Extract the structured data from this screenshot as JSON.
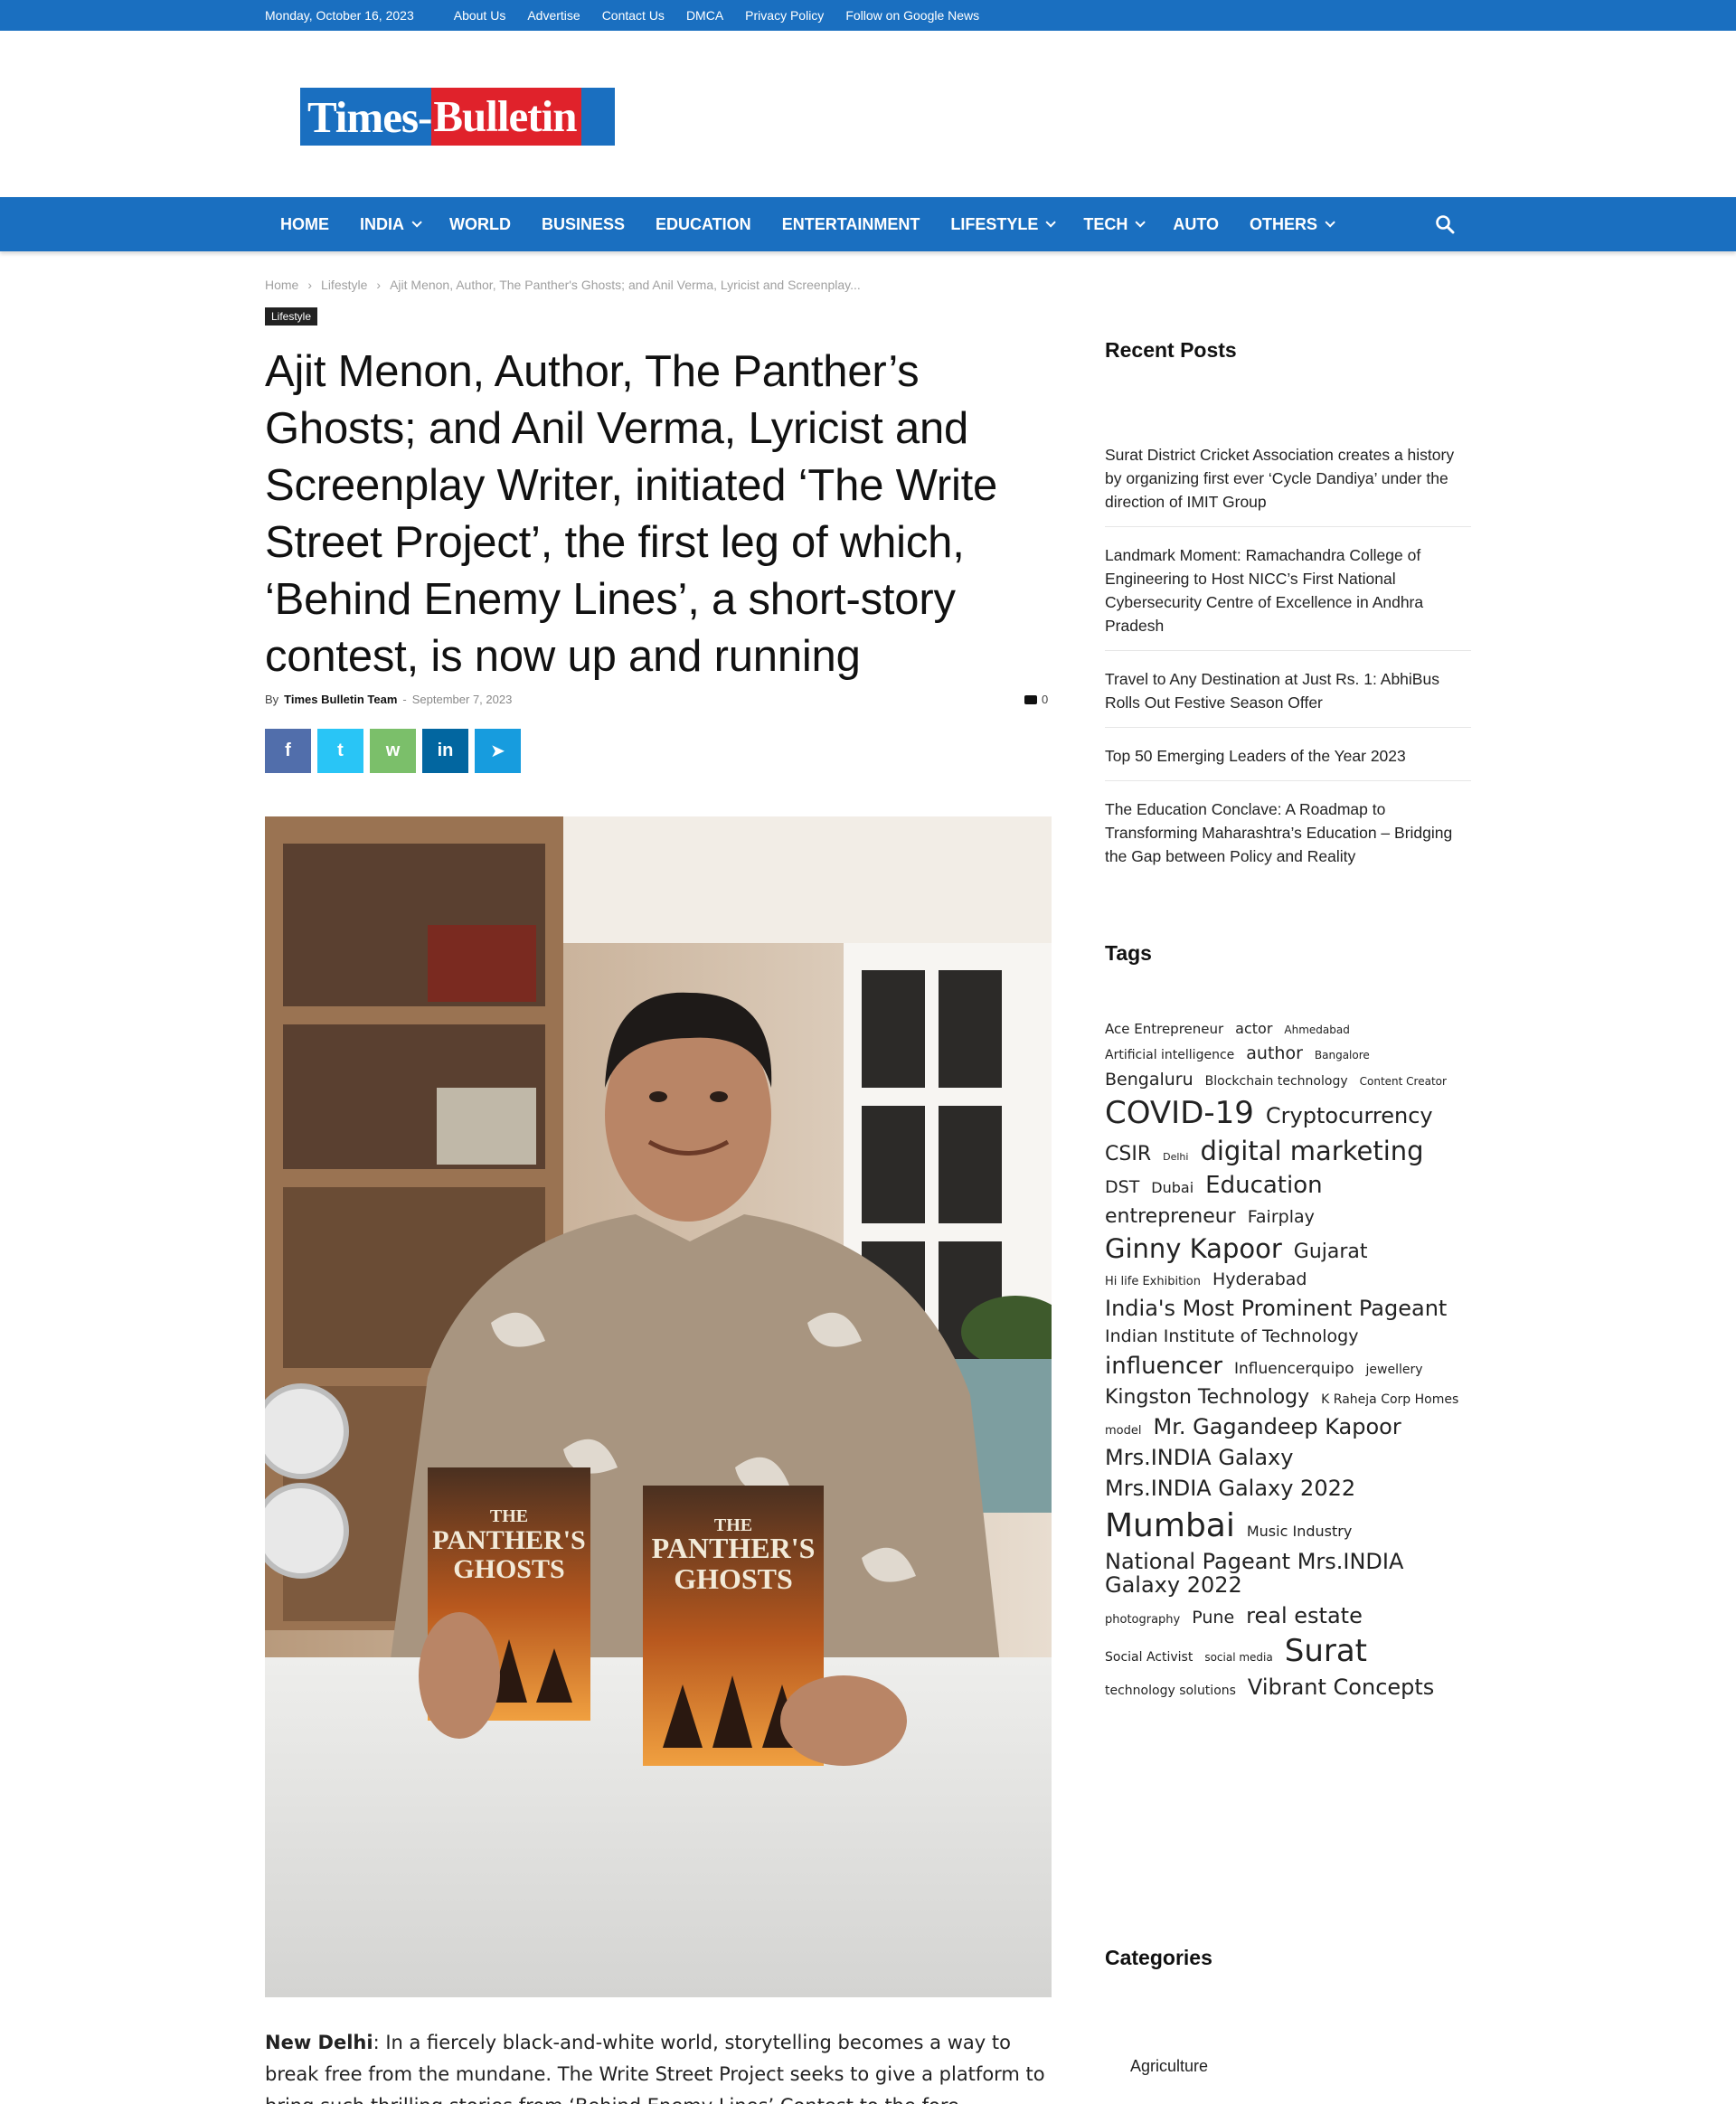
{
  "topbar": {
    "date": "Monday, October 16, 2023",
    "links": [
      "About Us",
      "Advertise",
      "Contact Us",
      "DMCA",
      "Privacy Policy",
      "Follow on Google News"
    ]
  },
  "logo": {
    "part1": "Times-",
    "part2": "Bulletin"
  },
  "nav": {
    "items": [
      {
        "label": "HOME",
        "dropdown": false
      },
      {
        "label": "INDIA",
        "dropdown": true
      },
      {
        "label": "WORLD",
        "dropdown": false
      },
      {
        "label": "BUSINESS",
        "dropdown": false
      },
      {
        "label": "EDUCATION",
        "dropdown": false
      },
      {
        "label": "ENTERTAINMENT",
        "dropdown": false
      },
      {
        "label": "LIFESTYLE",
        "dropdown": true
      },
      {
        "label": "TECH",
        "dropdown": true
      },
      {
        "label": "AUTO",
        "dropdown": false
      },
      {
        "label": "OTHERS",
        "dropdown": true
      }
    ],
    "search_icon": "search-icon"
  },
  "breadcrumb": {
    "home": "Home",
    "section": "Lifestyle",
    "current": "Ajit Menon, Author, The Panther's Ghosts; and Anil Verma, Lyricist and Screenplay..."
  },
  "article": {
    "category": "Lifestyle",
    "title": "Ajit Menon, Author, The Panther’s Ghosts; and Anil Verma, Lyricist and Screenplay Writer, initiated ‘The Write Street Project’, the first leg of which, ‘Behind Enemy Lines’, a short-story contest, is now up and running",
    "by": "By",
    "author": "Times Bulletin Team",
    "dash": "-",
    "date": "September 7, 2023",
    "comments": "0",
    "share": [
      {
        "name": "facebook",
        "glyph": "f",
        "color": "#516eab"
      },
      {
        "name": "twitter",
        "glyph": "t",
        "color": "#29c5f6"
      },
      {
        "name": "whatsapp",
        "glyph": "w",
        "color": "#7bbf6a"
      },
      {
        "name": "linkedin",
        "glyph": "in",
        "color": "#0266a0"
      },
      {
        "name": "telegram",
        "glyph": "➤",
        "color": "#179cde"
      }
    ],
    "photo_book_title_line1": "THE",
    "photo_book_title_line2": "PANTHER'S",
    "photo_book_title_line3": "GHOSTS",
    "lead_city": "New Delhi",
    "lead_text": ": In a fiercely black-and-white world, storytelling becomes a way to break free from the mundane. The Write Street Project seeks to give a platform to bring such thrilling stories from ‘Behind Enemy Lines’ Contest to the fore."
  },
  "sidebar": {
    "recent_heading": "Recent Posts",
    "recent_posts": [
      "Surat District Cricket Association creates a history by organizing first ever ‘Cycle Dandiya’ under the direction of IMIT Group",
      "Landmark Moment: Ramachandra College of Engineering to Host NICC’s First National Cybersecurity Centre of Excellence in Andhra Pradesh",
      "Travel to Any Destination at Just Rs. 1: AbhiBus Rolls Out Festive Season Offer",
      "Top 50 Emerging Leaders of the Year 2023",
      "The Education Conclave: A Roadmap to Transforming Maharashtra’s Education – Bridging the Gap between Policy and Reality"
    ],
    "tags_heading": "Tags",
    "tags": [
      {
        "label": "Ace Entrepreneur",
        "size": 15
      },
      {
        "label": "actor",
        "size": 16
      },
      {
        "label": "Ahmedabad",
        "size": 12
      },
      {
        "label": "Artificial intelligence",
        "size": 14
      },
      {
        "label": "author",
        "size": 19
      },
      {
        "label": "Bangalore",
        "size": 12
      },
      {
        "label": "Bengaluru",
        "size": 19
      },
      {
        "label": "Blockchain technology",
        "size": 14
      },
      {
        "label": "Content Creator",
        "size": 12
      },
      {
        "label": "COVID-19",
        "size": 34
      },
      {
        "label": "Cryptocurrency",
        "size": 24
      },
      {
        "label": "CSIR",
        "size": 22
      },
      {
        "label": "Delhi",
        "size": 11
      },
      {
        "label": "digital marketing",
        "size": 29
      },
      {
        "label": "DST",
        "size": 19
      },
      {
        "label": "Dubai",
        "size": 16
      },
      {
        "label": "Education",
        "size": 26
      },
      {
        "label": "entrepreneur",
        "size": 22
      },
      {
        "label": "Fairplay",
        "size": 19
      },
      {
        "label": "Ginny Kapoor",
        "size": 29
      },
      {
        "label": "Gujarat",
        "size": 22
      },
      {
        "label": "Hi life Exhibition",
        "size": 13
      },
      {
        "label": "Hyderabad",
        "size": 19
      },
      {
        "label": "India's Most Prominent Pageant",
        "size": 24
      },
      {
        "label": "Indian Institute of Technology",
        "size": 19
      },
      {
        "label": "influencer",
        "size": 26
      },
      {
        "label": "Influencerquipo",
        "size": 17
      },
      {
        "label": "jewellery",
        "size": 14
      },
      {
        "label": "Kingston Technology",
        "size": 22
      },
      {
        "label": "K Raheja Corp Homes",
        "size": 14
      },
      {
        "label": "model",
        "size": 13
      },
      {
        "label": "Mr. Gagandeep Kapoor",
        "size": 24
      },
      {
        "label": "Mrs.INDIA Galaxy",
        "size": 24
      },
      {
        "label": "Mrs.INDIA Galaxy 2022",
        "size": 24
      },
      {
        "label": "Mumbai",
        "size": 36
      },
      {
        "label": "Music Industry",
        "size": 16
      },
      {
        "label": "National Pageant Mrs.INDIA Galaxy 2022",
        "size": 24
      },
      {
        "label": "photography",
        "size": 13
      },
      {
        "label": "Pune",
        "size": 19
      },
      {
        "label": "real estate",
        "size": 24
      },
      {
        "label": "Social Activist",
        "size": 14
      },
      {
        "label": "social media",
        "size": 12
      },
      {
        "label": "Surat",
        "size": 34
      },
      {
        "label": "technology solutions",
        "size": 14
      },
      {
        "label": "Vibrant Concepts",
        "size": 24
      }
    ],
    "categories_heading": "Categories",
    "categories": [
      "Agriculture"
    ]
  },
  "colors": {
    "brand_blue": "#1a6fc0",
    "logo_red": "#e0222b"
  }
}
